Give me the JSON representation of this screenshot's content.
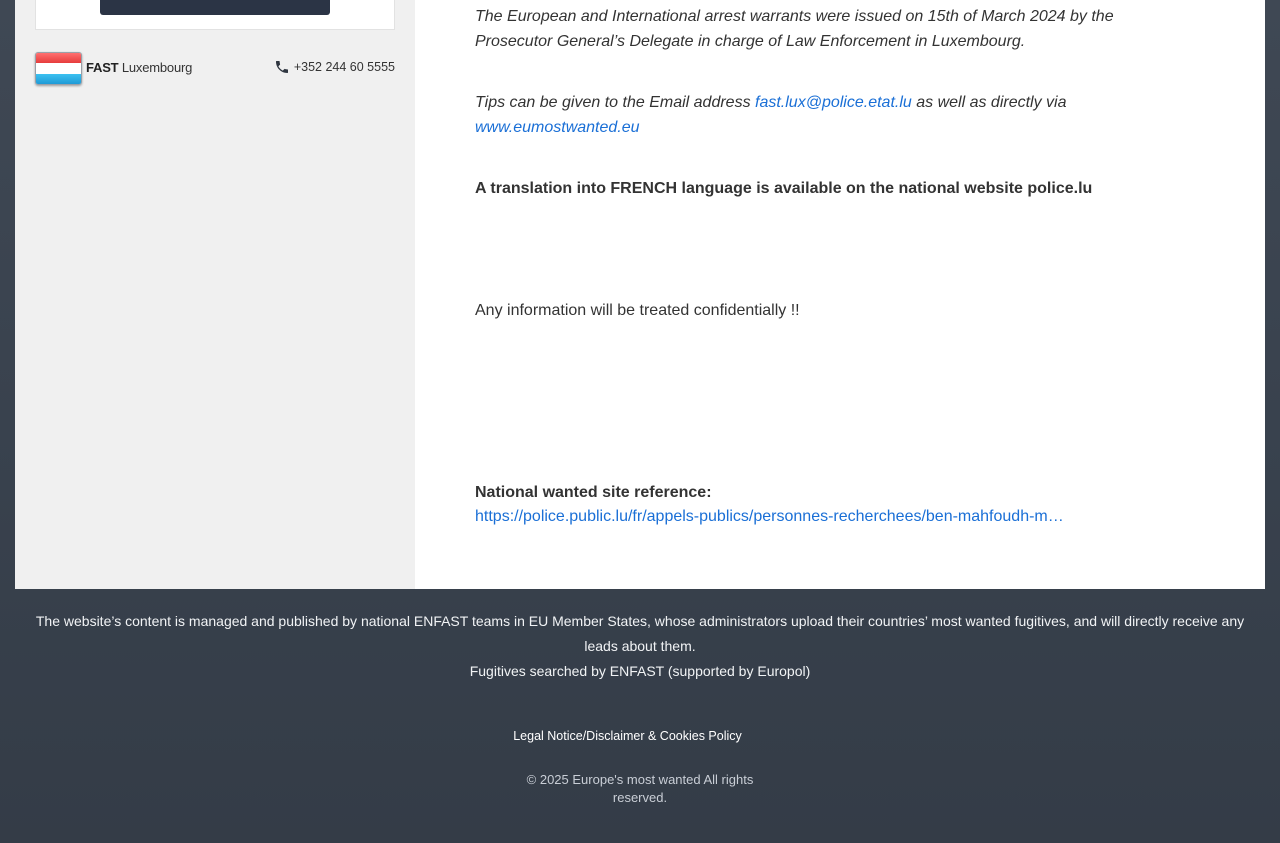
{
  "sidebar": {
    "unit": {
      "prefix": "FAST",
      "country": "Luxembourg",
      "phone": "+352 244 60 5555",
      "flag_colors": [
        "#ed2939",
        "#ffffff",
        "#00a1de"
      ]
    }
  },
  "main": {
    "warrant_text": "The European and International arrest warrants were issued on 15th of March 2024 by the Prosecutor General’s Delegate in charge of Law Enforcement in Luxembourg.",
    "tips_before": "Tips can be given to the Email address ",
    "tips_email": "fast.lux@police.etat.lu",
    "tips_middle": " as well as directly via ",
    "tips_site": "www.eumostwanted.eu",
    "translation_note": "A translation into FRENCH language is available on the national website police.lu",
    "confidential_note": "Any information will be treated confidentially !!",
    "reference_label": "National wanted site reference:",
    "reference_url": "https://police.public.lu/fr/appels-publics/personnes-recherchees/ben-mahfoudh-m…"
  },
  "footer": {
    "managed_text": "The website’s content is managed and published by national ENFAST teams in EU Member States, whose administrators upload their countries’ most wanted fugitives, and will directly receive any leads about them.",
    "searched_text": "Fugitives searched by ENFAST (supported by Europol)",
    "legal_link": "Legal Notice/Disclaimer & Cookies Policy",
    "copyright": "© 2025 Europe's most wanted All rights reserved."
  },
  "colors": {
    "link": "#1a6fd6",
    "footer_bg": "#3c4550",
    "sidebar_bg": "#f0f0f0"
  }
}
